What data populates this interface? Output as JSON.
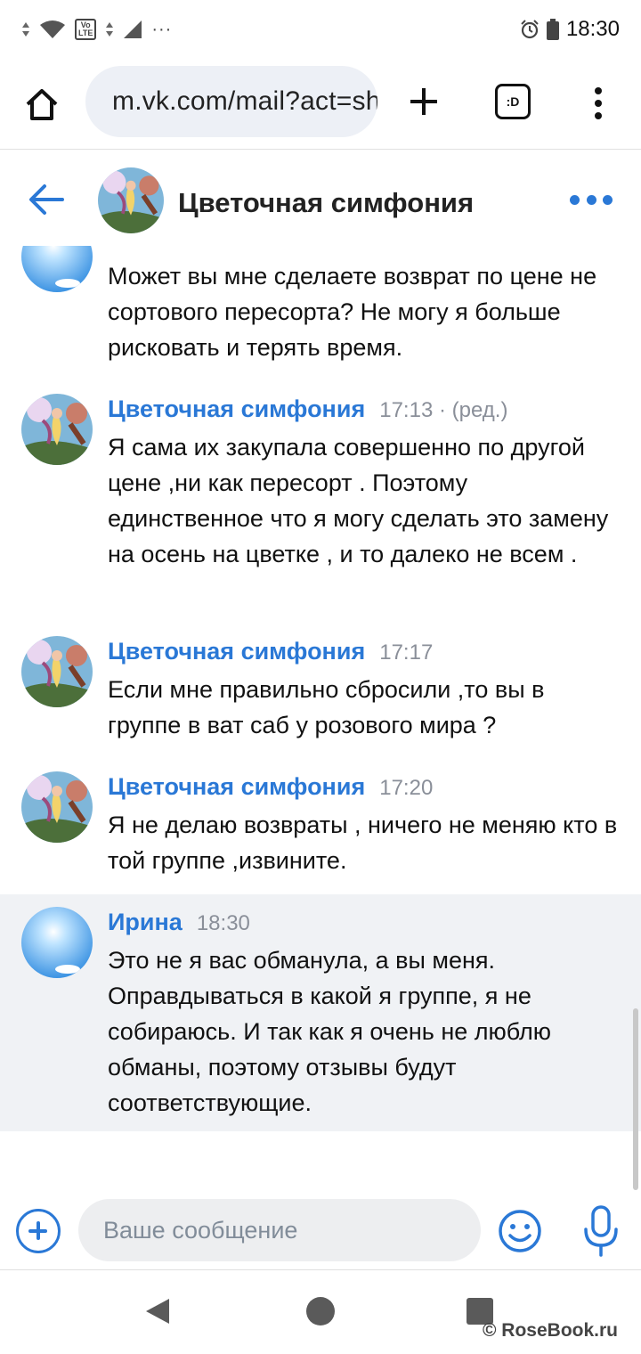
{
  "status_bar": {
    "time": "18:30",
    "network_badge_top": "Vo",
    "network_badge_bottom": "LTE",
    "more_indicator": "···"
  },
  "browser": {
    "url": "m.vk.com/mail?act=show&chat",
    "tabs_label": ":D"
  },
  "chat": {
    "title": "Цветочная симфония"
  },
  "messages": [
    {
      "author": "",
      "time": "",
      "edited": "",
      "text": "Может вы мне сделаете возврат по цене не сортового пересорта? Не могу я больше рисковать и терять время."
    },
    {
      "author": "Цветочная симфония",
      "time": "17:13",
      "edited": "· (ред.)",
      "text": "Я сама их закупала совершенно по другой цене ,ни как пересорт . Поэтому единственное что я могу сделать это замену на осень на цветке , и то далеко не всем ."
    },
    {
      "author": "Цветочная симфония",
      "time": "17:17",
      "edited": "",
      "text": "Если мне правильно сбросили ,то вы в группе в ват саб у розового мира ?"
    },
    {
      "author": "Цветочная симфония",
      "time": "17:20",
      "edited": "",
      "text": "Я не делаю возвраты , ничего не меняю кто в той группе ,извините."
    },
    {
      "author": "Ирина",
      "time": "18:30",
      "edited": "",
      "text": "Это не я вас обманула, а вы меня. Оправдываться в какой я группе, я не собираюсь. И так как я очень не люблю обманы, поэтому отзывы будут соответствующие."
    }
  ],
  "composer": {
    "placeholder": "Ваше сообщение"
  },
  "watermark": "© RoseBook.ru",
  "colors": {
    "accent": "#2a78d6",
    "meta_gray": "#8a8f99",
    "highlight_bg": "#f0f2f5",
    "input_bg": "#edeef0"
  }
}
